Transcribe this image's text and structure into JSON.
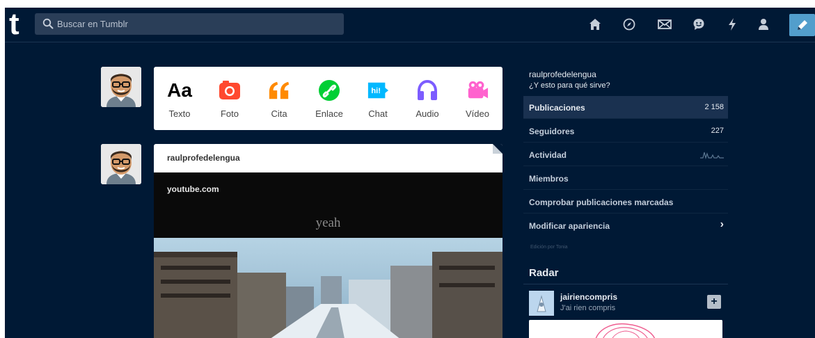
{
  "topbar": {
    "logo": "t",
    "search_placeholder": "Buscar en Tumblr",
    "icons": [
      "home-icon",
      "explore-icon",
      "inbox-icon",
      "messaging-icon",
      "activity-icon",
      "account-icon"
    ],
    "compose_icon": "pencil-icon",
    "accent": "#529ecc"
  },
  "post_types": [
    {
      "label": "Texto",
      "icon": "text-icon",
      "color": "#000000"
    },
    {
      "label": "Foto",
      "icon": "camera-icon",
      "color": "#ff492f"
    },
    {
      "label": "Cita",
      "icon": "quote-icon",
      "color": "#ff8a00"
    },
    {
      "label": "Enlace",
      "icon": "link-icon",
      "color": "#00cf35"
    },
    {
      "label": "Chat",
      "icon": "chat-icon",
      "color": "#00b8ff"
    },
    {
      "label": "Audio",
      "icon": "headphones-icon",
      "color": "#7c5cff"
    },
    {
      "label": "Vídeo",
      "icon": "video-camera-icon",
      "color": "#ff62ce"
    }
  ],
  "text_type_glyph": "Aa",
  "chat_glyph": "hi!",
  "post": {
    "username": "raulprofedelengua",
    "source": "youtube.com",
    "video_title": "yeah"
  },
  "sidebar": {
    "blog_name": "raulprofedelengua",
    "blog_description": "¿Y esto para qué sirve?",
    "rows": [
      {
        "label": "Publicaciones",
        "value": "2 158"
      },
      {
        "label": "Seguidores",
        "value": "227"
      },
      {
        "label": "Actividad",
        "value": ""
      },
      {
        "label": "Miembros",
        "value": ""
      },
      {
        "label": "Comprobar publicaciones marcadas",
        "value": ""
      },
      {
        "label": "Modificar apariencia",
        "value": "›"
      }
    ],
    "theme_credit": "Edición por Tonia",
    "radar_title": "Radar",
    "radar_user": "jairiencompris",
    "radar_desc": "J'ai rien compris",
    "radar_follow": "+"
  },
  "colors": {
    "background": "#001935",
    "panel": "#ffffff"
  }
}
